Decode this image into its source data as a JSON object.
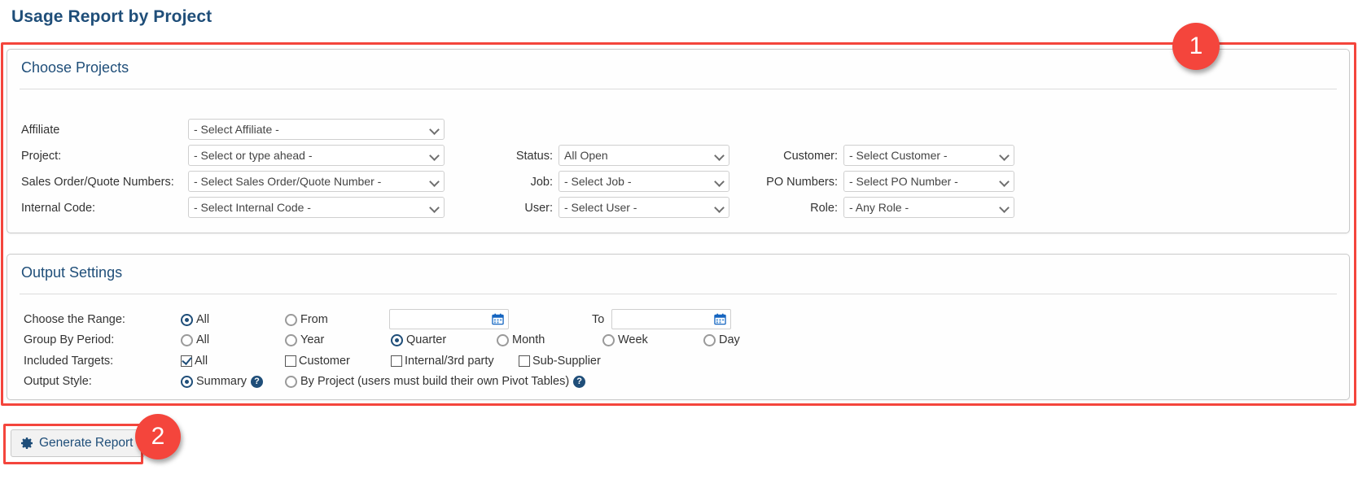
{
  "page": {
    "title": "Usage Report by Project"
  },
  "annotations": [
    {
      "id": "1",
      "label": "1"
    },
    {
      "id": "2",
      "label": "2"
    }
  ],
  "choose_projects": {
    "title": "Choose Projects",
    "left_fields": [
      {
        "label": "Affiliate",
        "value": "- Select Affiliate -"
      },
      {
        "label": "Project:",
        "value": "- Select or type ahead -"
      },
      {
        "label": "Sales Order/Quote Numbers:",
        "value": "- Select Sales Order/Quote Number -"
      },
      {
        "label": "Internal Code:",
        "value": "- Select Internal Code -"
      }
    ],
    "middle_fields": [
      {
        "label": "Status:",
        "value": "All Open"
      },
      {
        "label": "Job:",
        "value": "- Select Job -"
      },
      {
        "label": "User:",
        "value": "- Select User -"
      }
    ],
    "right_fields": [
      {
        "label": "Customer:",
        "value": "- Select Customer -"
      },
      {
        "label": "PO Numbers:",
        "value": "- Select PO Number -"
      },
      {
        "label": "Role:",
        "value": "- Any Role -"
      }
    ]
  },
  "output_settings": {
    "title": "Output Settings",
    "range": {
      "label": "Choose the Range:",
      "options": [
        {
          "label": "All",
          "selected": true
        },
        {
          "label": "From",
          "selected": false
        }
      ],
      "from_value": "",
      "from_placeholder": "",
      "to_label": "To",
      "to_value": "",
      "to_placeholder": ""
    },
    "group_by_period": {
      "label": "Group By Period:",
      "options": [
        {
          "label": "All",
          "selected": false
        },
        {
          "label": "Year",
          "selected": false
        },
        {
          "label": "Quarter",
          "selected": true
        },
        {
          "label": "Month",
          "selected": false
        },
        {
          "label": "Week",
          "selected": false
        },
        {
          "label": "Day",
          "selected": false
        }
      ]
    },
    "included_targets": {
      "label": "Included Targets:",
      "options": [
        {
          "label": "All",
          "checked": true
        },
        {
          "label": "Customer",
          "checked": false
        },
        {
          "label": "Internal/3rd party",
          "checked": false
        },
        {
          "label": "Sub-Supplier",
          "checked": false
        }
      ]
    },
    "output_style": {
      "label": "Output Style:",
      "options": [
        {
          "label": "Summary",
          "selected": true,
          "help": "?"
        },
        {
          "label": "By Project (users must build their own Pivot Tables)",
          "selected": false,
          "help": "?"
        }
      ]
    }
  },
  "actions": {
    "generate_label": "Generate Report"
  },
  "colors": {
    "accent": "#1f4e79",
    "annotation": "#f4453c",
    "panel_border": "#c9c9c9"
  }
}
